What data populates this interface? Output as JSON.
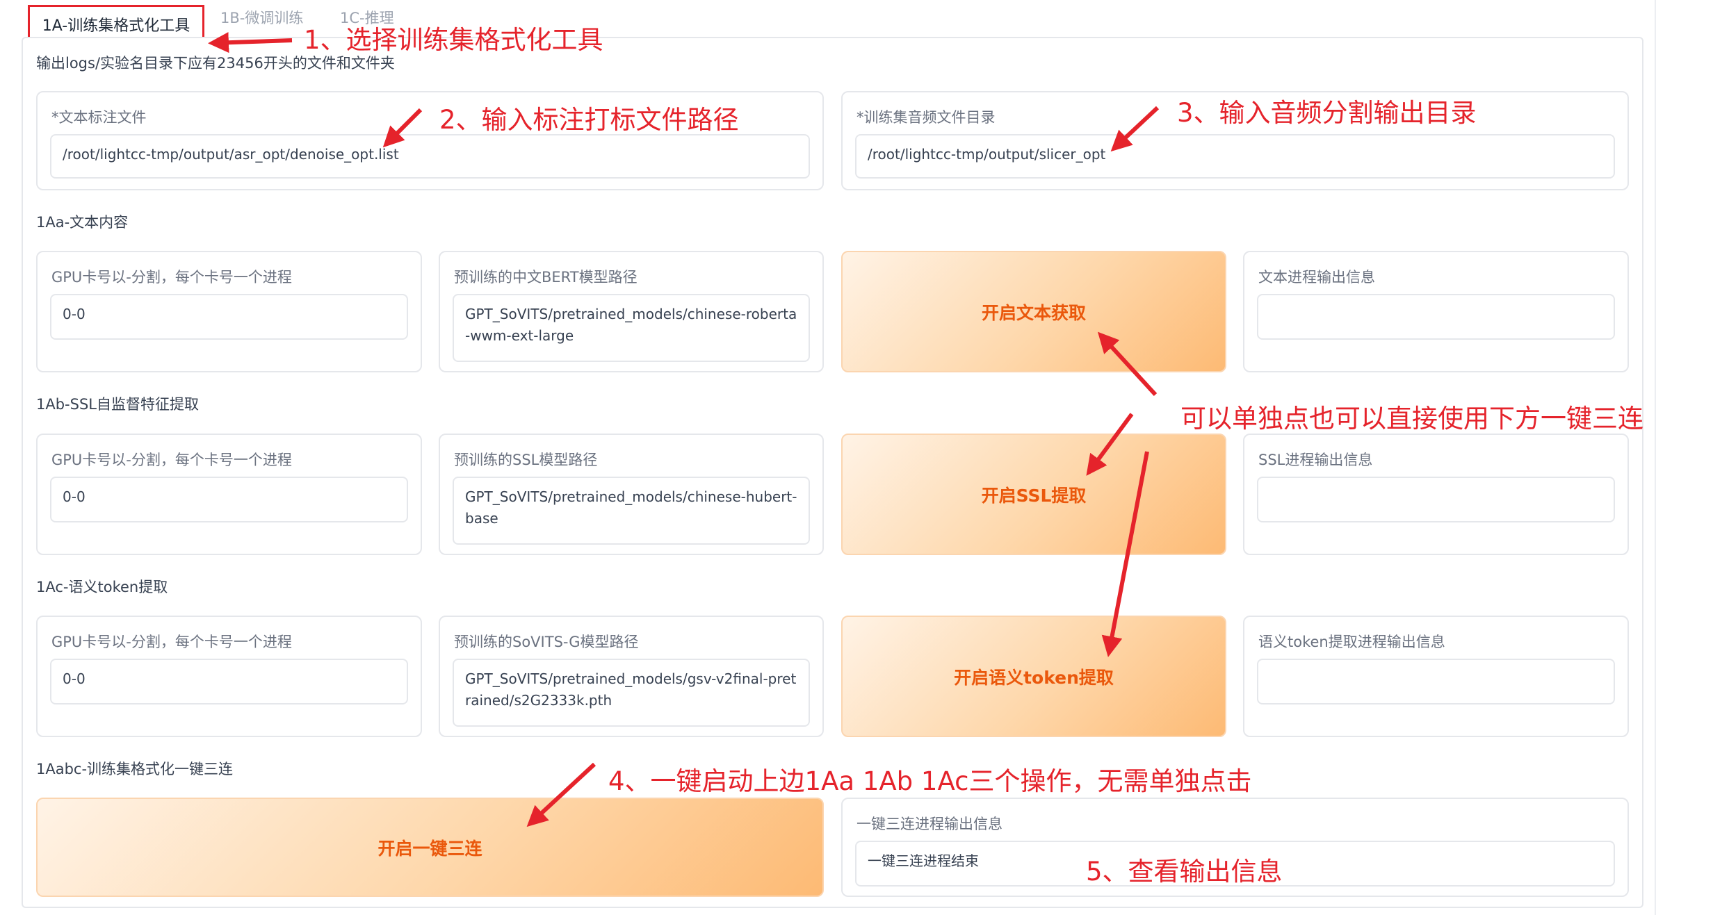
{
  "tabs": [
    {
      "label": "1A-训练集格式化工具"
    },
    {
      "label": "1B-微调训练"
    },
    {
      "label": "1C-推理"
    }
  ],
  "intro": "输出logs/实验名目录下应有23456开头的文件和文件夹",
  "paths": {
    "text_label": "*文本标注文件",
    "text_value": "/root/lightcc-tmp/output/asr_opt/denoise_opt.list",
    "audio_label": "*训练集音频文件目录",
    "audio_value": "/root/lightcc-tmp/output/slicer_opt"
  },
  "sections": [
    {
      "title": "1Aa-文本内容",
      "gpu_label": "GPU卡号以-分割，每个卡号一个进程",
      "gpu_value": "0-0",
      "model_label": "预训练的中文BERT模型路径",
      "model_value": "GPT_SoVITS/pretrained_models/chinese-roberta-wwm-ext-large",
      "button": "开启文本获取",
      "output_label": "文本进程输出信息",
      "output_value": ""
    },
    {
      "title": "1Ab-SSL自监督特征提取",
      "gpu_label": "GPU卡号以-分割，每个卡号一个进程",
      "gpu_value": "0-0",
      "model_label": "预训练的SSL模型路径",
      "model_value": "GPT_SoVITS/pretrained_models/chinese-hubert-base",
      "button": "开启SSL提取",
      "output_label": "SSL进程输出信息",
      "output_value": ""
    },
    {
      "title": "1Ac-语义token提取",
      "gpu_label": "GPU卡号以-分割，每个卡号一个进程",
      "gpu_value": "0-0",
      "model_label": "预训练的SoVITS-G模型路径",
      "model_value": "GPT_SoVITS/pretrained_models/gsv-v2final-pretrained/s2G2333k.pth",
      "button": "开启语义token提取",
      "output_label": "语义token提取进程输出信息",
      "output_value": ""
    }
  ],
  "oneclick": {
    "title": "1Aabc-训练集格式化一键三连",
    "button": "开启一键三连",
    "output_label": "一键三连进程输出信息",
    "output_value": "一键三连进程结束"
  },
  "annotations": {
    "a1": "1、选择训练集格式化工具",
    "a2": "2、输入标注打标文件路径",
    "a3": "3、输入音频分割输出目录",
    "a_mid": "可以单独点也可以直接使用下方一键三连",
    "a4": "4、一键启动上边1Aa 1Ab 1Ac三个操作，无需单独点击",
    "a5": "5、查看输出信息"
  },
  "colors": {
    "annotation": "#e5232b",
    "button_text": "#ea580c",
    "button_gradient_end": "#fdba74"
  }
}
